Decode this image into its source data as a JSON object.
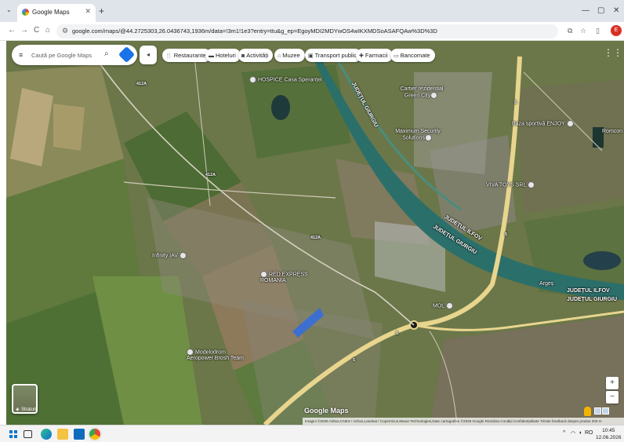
{
  "browser": {
    "tab_title": "Google Maps",
    "tab_close": "✕",
    "new_tab": "+",
    "tab_search": "⌄",
    "window_controls": [
      "—",
      "▢",
      "✕"
    ],
    "url": "google.com/maps/@44.2725303,26.0436743,1936m/data=!3m1!1e3?entry=ttu&g_ep=EgoyMDI2MDYwOS4wIKXMDSoASAFQAw%3D%3D",
    "nav": {
      "back": "←",
      "forward": "→",
      "reload": "C",
      "home": "⌂"
    },
    "toolbar_icons": [
      "⧉",
      "☆",
      "▯"
    ],
    "profile": "E"
  },
  "maps": {
    "search_placeholder": "Caută pe Google Maps",
    "menu_icon": "≡",
    "search_icon": "⌕",
    "collapse_icon": "◂",
    "chips": [
      {
        "icon": "fork-knife-icon",
        "glyph": "🍴",
        "label": "Restaurante"
      },
      {
        "icon": "bed-icon",
        "glyph": "▬",
        "label": "Hoteluri"
      },
      {
        "icon": "camera-icon",
        "glyph": "◙",
        "label": "Activități"
      },
      {
        "icon": "museum-icon",
        "glyph": "⌂",
        "label": "Muzee"
      },
      {
        "icon": "bus-icon",
        "glyph": "▣",
        "label": "Transport public"
      },
      {
        "icon": "pharmacy-icon",
        "glyph": "✚",
        "label": "Farmacii"
      },
      {
        "icon": "atm-icon",
        "glyph": "▭",
        "label": "Bancomate"
      }
    ],
    "apps_icon": "⋮⋮",
    "pois": [
      {
        "label": "HOSPICE Casa Speranței"
      },
      {
        "label": "Cartier rezidențial Green City"
      },
      {
        "label": "Maximum Security Solutions"
      },
      {
        "label": "Baza sportivă ENJOY"
      },
      {
        "label": "Romcon"
      },
      {
        "label": "VIVA TOYS SRL"
      },
      {
        "label": "Infinity IAV"
      },
      {
        "label": "RED EXPRESS ROMANIA"
      },
      {
        "label": "MOL"
      },
      {
        "label": "Modelodrom Aeropower Brosh Team"
      }
    ],
    "area_labels": [
      "JUDEȚUL GIURGIU",
      "JUDEȚUL ILFOV",
      "JUDEȚUL GIURGIU",
      "JUDEȚUL ILFOV",
      "JUDEȚUL GIURGIU",
      "Argeș"
    ],
    "road_labels": [
      "412A",
      "412A",
      "412A",
      "5",
      "5",
      "5",
      "5"
    ],
    "layers_label": "Straturi",
    "google_logo": "Google Maps",
    "attribution": "Imagini ©2026 Airbus,CNES / Airbus,Landsat / Copernicus,Maxar Technologies,Date cartografice ©2026 Google    România    Condiții    Confidențialitate    Trimite feedback despre produs    200 m",
    "zoom_in": "+",
    "zoom_out": "−"
  },
  "taskbar": {
    "tray": "^",
    "lang": "RO",
    "time": "10:45",
    "date": "12.06.2026"
  },
  "colors": {
    "field_green": "#5f7a3c",
    "river": "#2b6f6a",
    "road": "#e8d58e",
    "chrome_tab_bar": "#dfe3ea"
  }
}
